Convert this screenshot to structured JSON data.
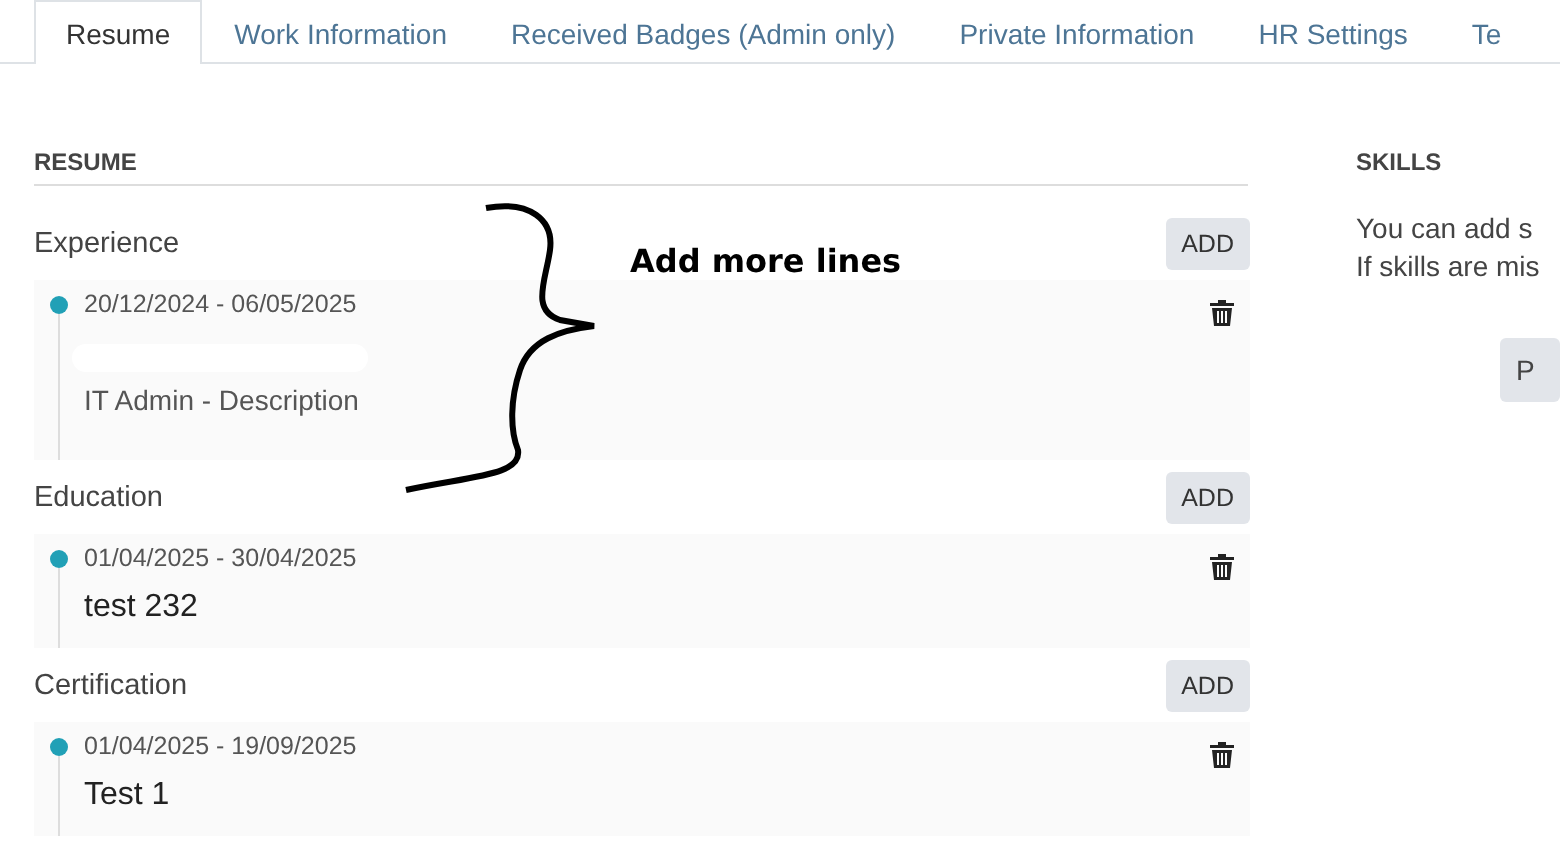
{
  "tabs": [
    {
      "label": "Resume",
      "selected": true
    },
    {
      "label": "Work Information",
      "selected": false
    },
    {
      "label": "Received Badges (Admin only)",
      "selected": false
    },
    {
      "label": "Private Information",
      "selected": false
    },
    {
      "label": "HR Settings",
      "selected": false
    },
    {
      "label": "Te",
      "selected": false
    }
  ],
  "resume": {
    "heading": "RESUME",
    "sections": [
      {
        "name": "Experience",
        "add_button": "ADD",
        "entries": [
          {
            "lines": [
              {
                "kind": "date",
                "text": "20/12/2024 - 06/05/2025"
              },
              {
                "kind": "redacted"
              },
              {
                "kind": "description",
                "text": "IT Admin - Description"
              }
            ]
          }
        ]
      },
      {
        "name": "Education",
        "add_button": "ADD",
        "entries": [
          {
            "lines": [
              {
                "kind": "date",
                "text": "01/04/2025 - 30/04/2025"
              },
              {
                "kind": "title",
                "text": "test 232"
              }
            ]
          }
        ]
      },
      {
        "name": "Certification",
        "add_button": "ADD",
        "entries": [
          {
            "lines": [
              {
                "kind": "date",
                "text": "01/04/2025 - 19/09/2025"
              },
              {
                "kind": "title",
                "text": "Test 1"
              }
            ]
          }
        ]
      }
    ]
  },
  "skills": {
    "heading": "SKILLS",
    "lines": [
      "You can add s",
      "If skills are mis"
    ],
    "button": "P"
  },
  "annotation": {
    "text": "Add more lines"
  }
}
